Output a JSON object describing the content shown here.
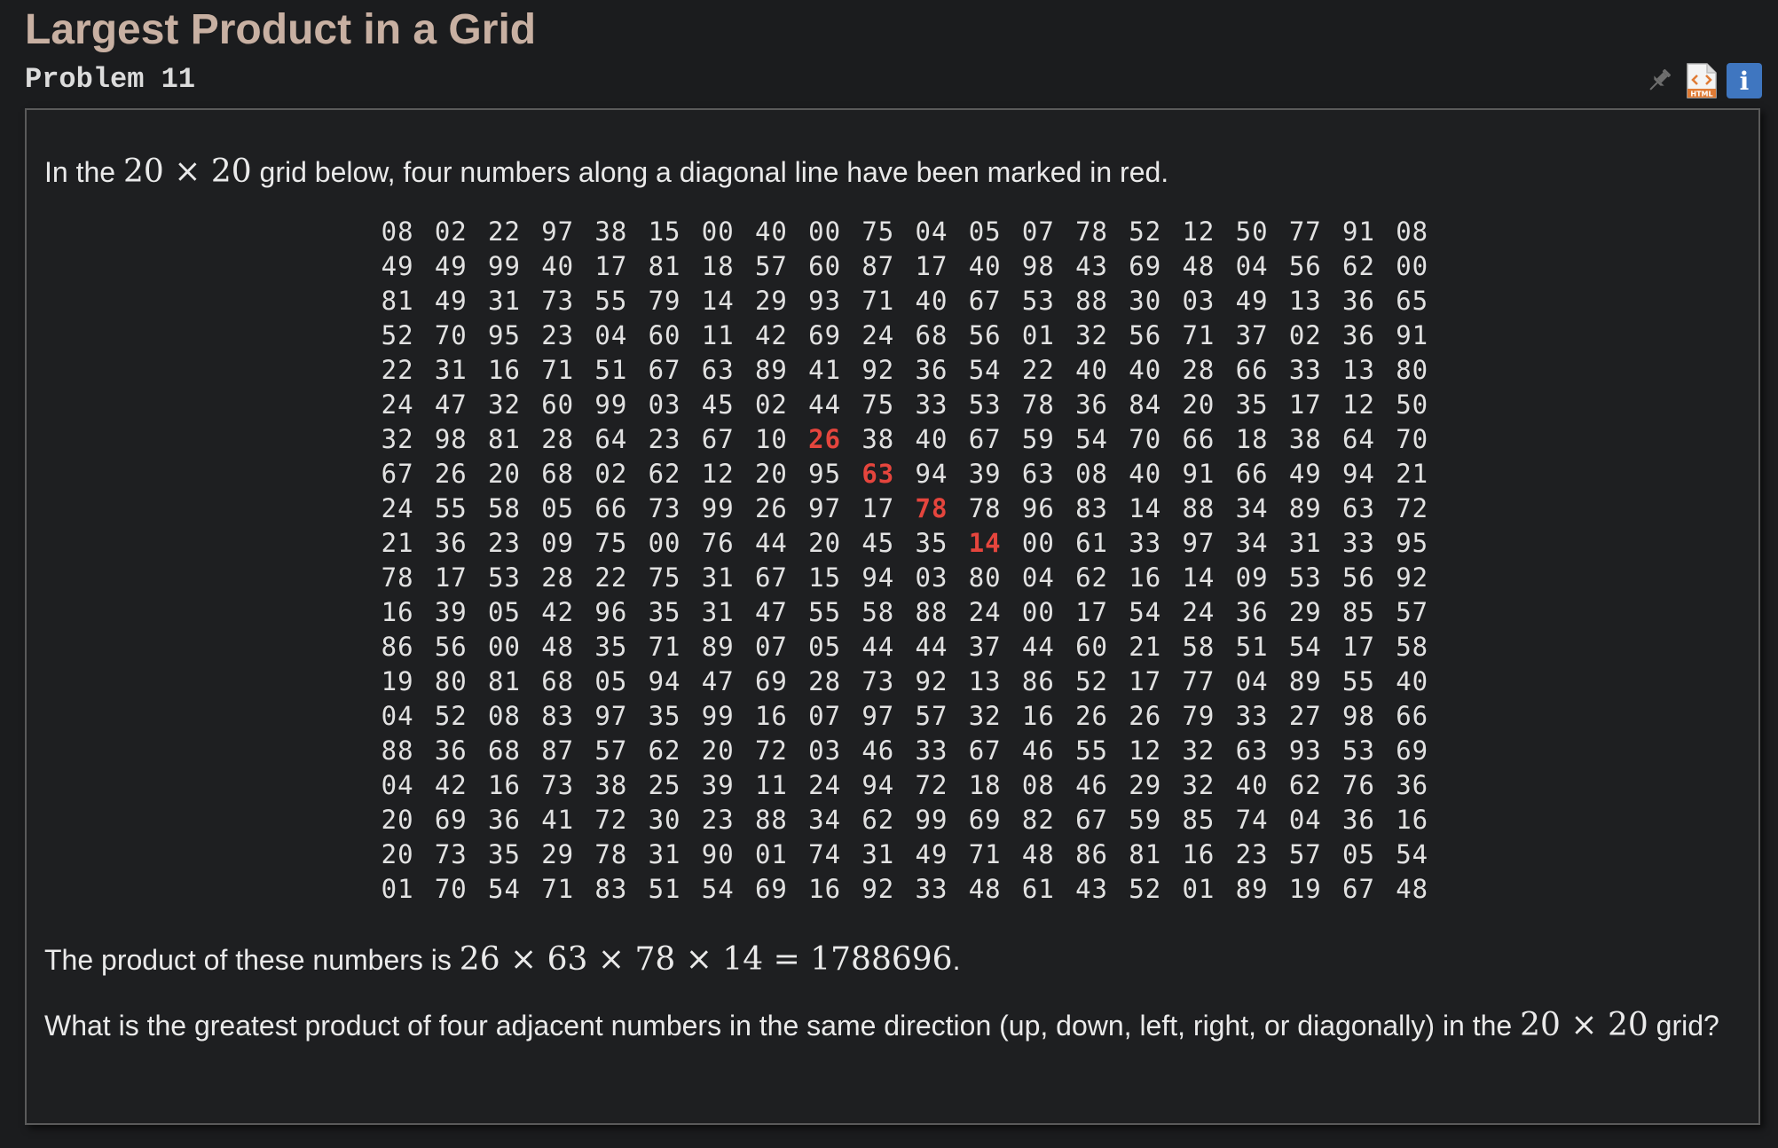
{
  "title": "Largest Product in a Grid",
  "problem_label": "Problem 11",
  "toolbar": {
    "icons": [
      "pin-icon",
      "html-icon",
      "info-icon"
    ],
    "info_label": "i",
    "html_label": "HTML"
  },
  "intro": {
    "before": "In the ",
    "math": "20 × 20",
    "after": " grid below, four numbers along a diagonal line have been marked in red."
  },
  "marked_color": "#e5453d",
  "grid": [
    [
      "08",
      "02",
      "22",
      "97",
      "38",
      "15",
      "00",
      "40",
      "00",
      "75",
      "04",
      "05",
      "07",
      "78",
      "52",
      "12",
      "50",
      "77",
      "91",
      "08"
    ],
    [
      "49",
      "49",
      "99",
      "40",
      "17",
      "81",
      "18",
      "57",
      "60",
      "87",
      "17",
      "40",
      "98",
      "43",
      "69",
      "48",
      "04",
      "56",
      "62",
      "00"
    ],
    [
      "81",
      "49",
      "31",
      "73",
      "55",
      "79",
      "14",
      "29",
      "93",
      "71",
      "40",
      "67",
      "53",
      "88",
      "30",
      "03",
      "49",
      "13",
      "36",
      "65"
    ],
    [
      "52",
      "70",
      "95",
      "23",
      "04",
      "60",
      "11",
      "42",
      "69",
      "24",
      "68",
      "56",
      "01",
      "32",
      "56",
      "71",
      "37",
      "02",
      "36",
      "91"
    ],
    [
      "22",
      "31",
      "16",
      "71",
      "51",
      "67",
      "63",
      "89",
      "41",
      "92",
      "36",
      "54",
      "22",
      "40",
      "40",
      "28",
      "66",
      "33",
      "13",
      "80"
    ],
    [
      "24",
      "47",
      "32",
      "60",
      "99",
      "03",
      "45",
      "02",
      "44",
      "75",
      "33",
      "53",
      "78",
      "36",
      "84",
      "20",
      "35",
      "17",
      "12",
      "50"
    ],
    [
      "32",
      "98",
      "81",
      "28",
      "64",
      "23",
      "67",
      "10",
      "26",
      "38",
      "40",
      "67",
      "59",
      "54",
      "70",
      "66",
      "18",
      "38",
      "64",
      "70"
    ],
    [
      "67",
      "26",
      "20",
      "68",
      "02",
      "62",
      "12",
      "20",
      "95",
      "63",
      "94",
      "39",
      "63",
      "08",
      "40",
      "91",
      "66",
      "49",
      "94",
      "21"
    ],
    [
      "24",
      "55",
      "58",
      "05",
      "66",
      "73",
      "99",
      "26",
      "97",
      "17",
      "78",
      "78",
      "96",
      "83",
      "14",
      "88",
      "34",
      "89",
      "63",
      "72"
    ],
    [
      "21",
      "36",
      "23",
      "09",
      "75",
      "00",
      "76",
      "44",
      "20",
      "45",
      "35",
      "14",
      "00",
      "61",
      "33",
      "97",
      "34",
      "31",
      "33",
      "95"
    ],
    [
      "78",
      "17",
      "53",
      "28",
      "22",
      "75",
      "31",
      "67",
      "15",
      "94",
      "03",
      "80",
      "04",
      "62",
      "16",
      "14",
      "09",
      "53",
      "56",
      "92"
    ],
    [
      "16",
      "39",
      "05",
      "42",
      "96",
      "35",
      "31",
      "47",
      "55",
      "58",
      "88",
      "24",
      "00",
      "17",
      "54",
      "24",
      "36",
      "29",
      "85",
      "57"
    ],
    [
      "86",
      "56",
      "00",
      "48",
      "35",
      "71",
      "89",
      "07",
      "05",
      "44",
      "44",
      "37",
      "44",
      "60",
      "21",
      "58",
      "51",
      "54",
      "17",
      "58"
    ],
    [
      "19",
      "80",
      "81",
      "68",
      "05",
      "94",
      "47",
      "69",
      "28",
      "73",
      "92",
      "13",
      "86",
      "52",
      "17",
      "77",
      "04",
      "89",
      "55",
      "40"
    ],
    [
      "04",
      "52",
      "08",
      "83",
      "97",
      "35",
      "99",
      "16",
      "07",
      "97",
      "57",
      "32",
      "16",
      "26",
      "26",
      "79",
      "33",
      "27",
      "98",
      "66"
    ],
    [
      "88",
      "36",
      "68",
      "87",
      "57",
      "62",
      "20",
      "72",
      "03",
      "46",
      "33",
      "67",
      "46",
      "55",
      "12",
      "32",
      "63",
      "93",
      "53",
      "69"
    ],
    [
      "04",
      "42",
      "16",
      "73",
      "38",
      "25",
      "39",
      "11",
      "24",
      "94",
      "72",
      "18",
      "08",
      "46",
      "29",
      "32",
      "40",
      "62",
      "76",
      "36"
    ],
    [
      "20",
      "69",
      "36",
      "41",
      "72",
      "30",
      "23",
      "88",
      "34",
      "62",
      "99",
      "69",
      "82",
      "67",
      "59",
      "85",
      "74",
      "04",
      "36",
      "16"
    ],
    [
      "20",
      "73",
      "35",
      "29",
      "78",
      "31",
      "90",
      "01",
      "74",
      "31",
      "49",
      "71",
      "48",
      "86",
      "81",
      "16",
      "23",
      "57",
      "05",
      "54"
    ],
    [
      "01",
      "70",
      "54",
      "71",
      "83",
      "51",
      "54",
      "69",
      "16",
      "92",
      "33",
      "48",
      "61",
      "43",
      "52",
      "01",
      "89",
      "19",
      "67",
      "48"
    ]
  ],
  "marked_cells": [
    [
      6,
      8
    ],
    [
      7,
      9
    ],
    [
      8,
      10
    ],
    [
      9,
      11
    ]
  ],
  "product": {
    "before": "The product of these numbers is ",
    "math": "26 × 63 × 78 × 14 = 1788696",
    "after": "."
  },
  "question": {
    "before": "What is the greatest product of four adjacent numbers in the same direction (up, down, left, right, or diagonally) in the ",
    "math": "20 × 20",
    "after": " grid?"
  }
}
